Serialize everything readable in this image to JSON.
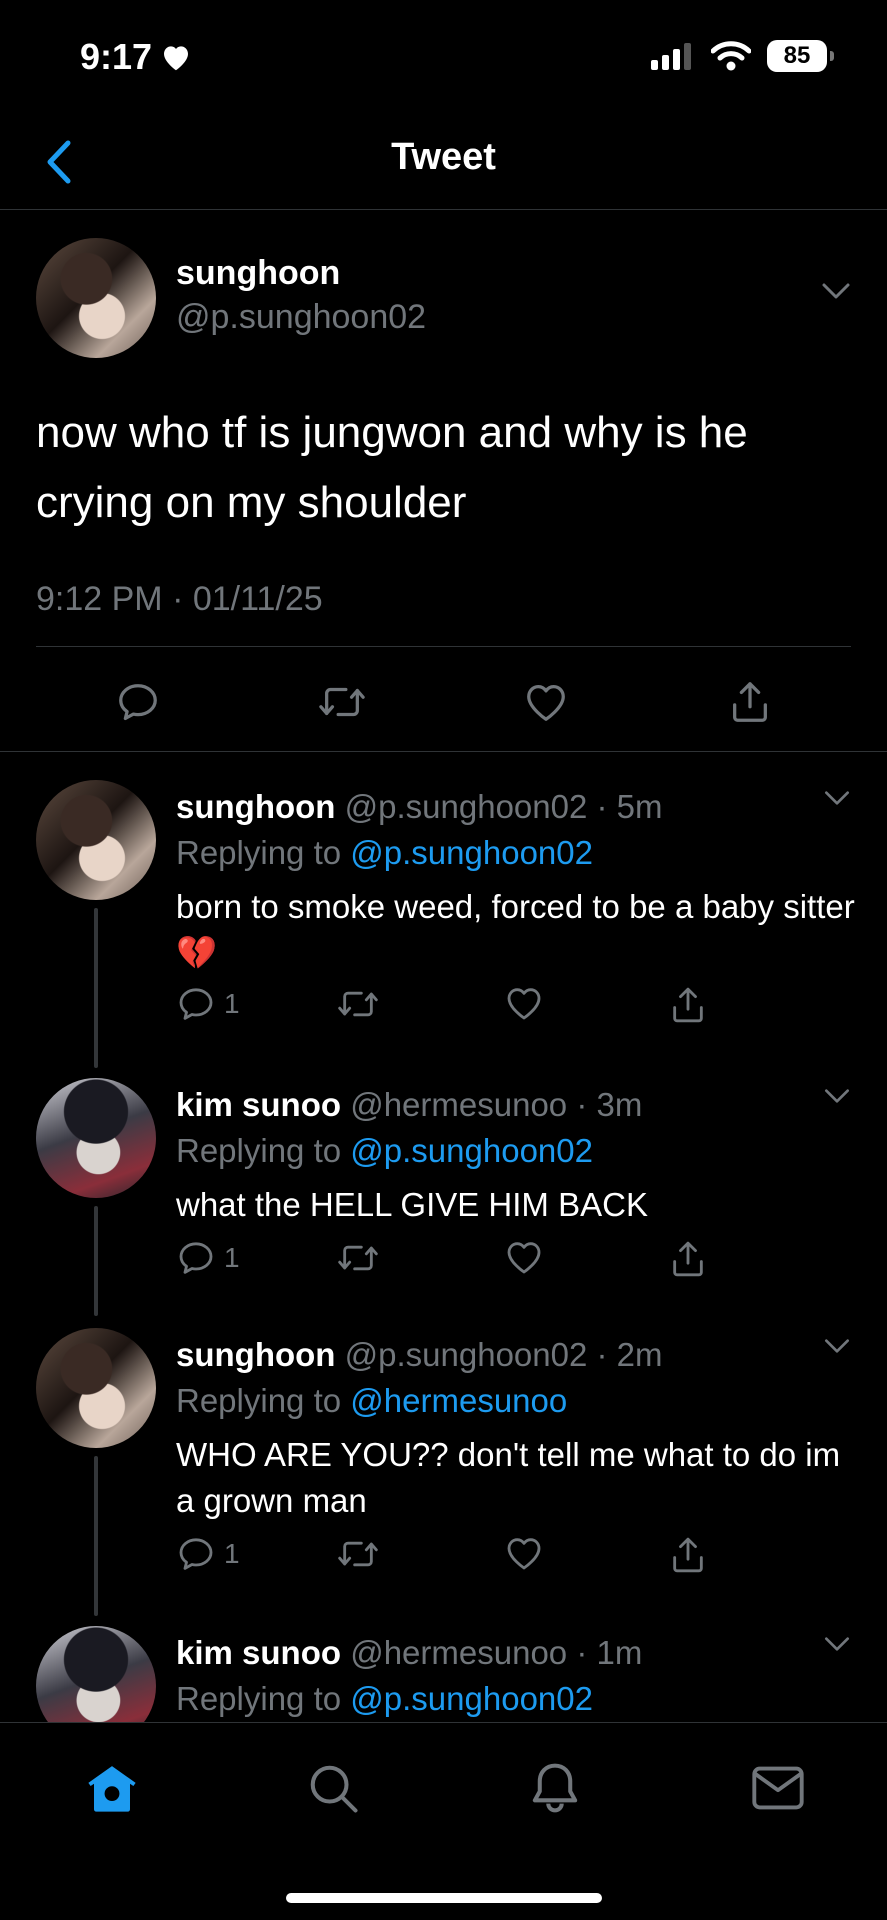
{
  "status_bar": {
    "time": "9:17",
    "battery": "85"
  },
  "nav": {
    "title": "Tweet"
  },
  "main_tweet": {
    "name": "sunghoon",
    "handle": "@p.sunghoon02",
    "text": "now who tf is jungwon and why is he crying on my shoulder",
    "timestamp": "9:12 PM · 01/11/25"
  },
  "replies": [
    {
      "name": "sunghoon",
      "meta": "@p.sunghoon02 · 5m",
      "replying_label": "Replying to",
      "replying_to": "@p.sunghoon02",
      "text": "born to smoke weed, forced to be a baby sitter 💔",
      "reply_count": "1"
    },
    {
      "name": "kim sunoo",
      "meta": "@hermesunoo · 3m",
      "replying_label": "Replying to",
      "replying_to": "@p.sunghoon02",
      "text": "what the HELL GIVE HIM BACK",
      "reply_count": "1"
    },
    {
      "name": "sunghoon",
      "meta": "@p.sunghoon02 · 2m",
      "replying_label": "Replying to",
      "replying_to": "@hermesunoo",
      "text": "WHO ARE YOU?? don't tell me what to do im a grown man",
      "reply_count": "1"
    },
    {
      "name": "kim sunoo",
      "meta": "@hermesunoo · 1m",
      "replying_label": "Replying to",
      "replying_to": "@p.sunghoon02"
    }
  ],
  "tab_bar": {
    "active": "home",
    "tabs": [
      "home",
      "search",
      "notifications",
      "messages"
    ]
  },
  "colors": {
    "accent": "#1d9bf0",
    "secondary_text": "#71767b",
    "background": "#000000"
  },
  "icons": [
    "chevron-left-icon",
    "chevron-down-icon",
    "reply-icon",
    "retweet-icon",
    "like-icon",
    "share-icon",
    "home-icon",
    "search-icon",
    "bell-icon",
    "mail-icon",
    "heart-filled-icon",
    "signal-icon",
    "wifi-icon"
  ]
}
